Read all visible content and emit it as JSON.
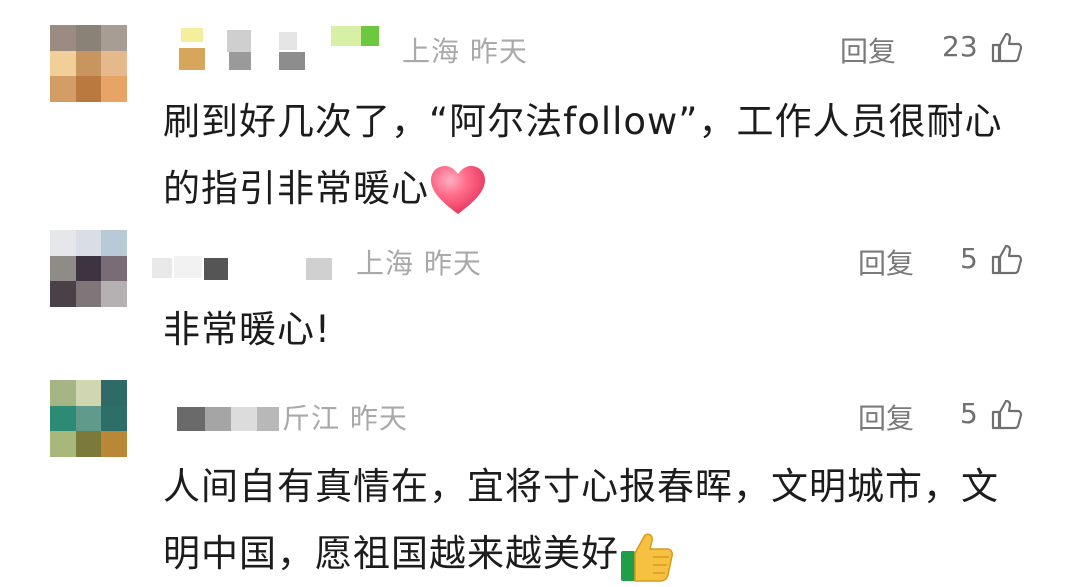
{
  "comments": [
    {
      "location_time": "上海 昨天",
      "reply_label": "回复",
      "like_count": "23",
      "text": "刷到好几次了，“阿尔法follow”，工作人员很耐心的指引非常暖心",
      "emoji": "heart-emoji"
    },
    {
      "location_time": "上海 昨天",
      "reply_label": "回复",
      "like_count": "5",
      "text": "非常暖心!"
    },
    {
      "location_time": "浙江 昨天",
      "location_partial": "斤江 昨天",
      "reply_label": "回复",
      "like_count": "5",
      "text": "人间自有真情在，宜将寸心报春晖，文明城市，文明中国，愿祖国越来越美好",
      "emoji": "thumbs-up-emoji"
    }
  ],
  "icons": {
    "like": "thumbs-up-outline-icon"
  },
  "colors": {
    "meta": "#a9a9a9",
    "reply": "#7a7a7a",
    "text": "#1c1c1c",
    "heart": "#ff5a78",
    "thumb_emoji": "#f6c040"
  }
}
